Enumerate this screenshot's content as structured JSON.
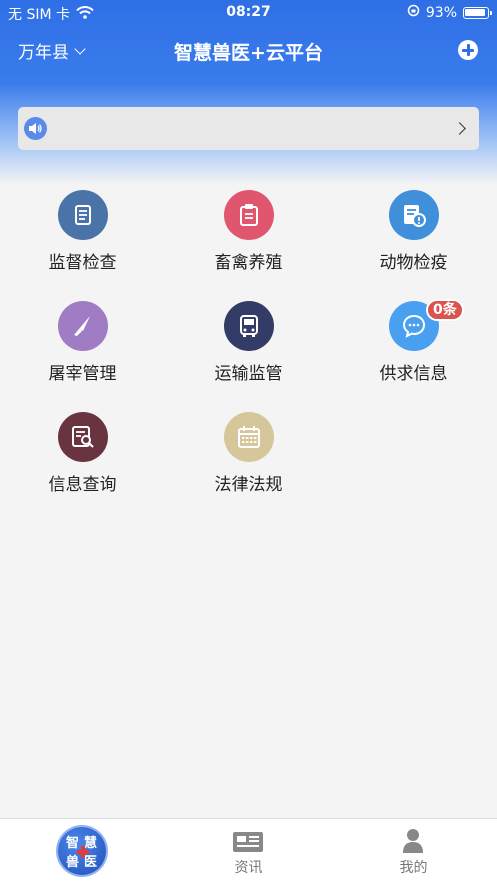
{
  "status_bar": {
    "carrier": "无 SIM 卡",
    "time": "08:27",
    "battery_percent": "93%",
    "battery_level": 0.93
  },
  "nav": {
    "county": "万年县",
    "title": "智慧兽医+云平台"
  },
  "notice": {
    "text": ""
  },
  "menu": {
    "items": [
      {
        "label": "监督检查",
        "icon": "scroll-icon",
        "color": "#4a74a8"
      },
      {
        "label": "畜禽养殖",
        "icon": "clipboard-icon",
        "color": "#e0566e"
      },
      {
        "label": "动物检疫",
        "icon": "document-alert-icon",
        "color": "#3f8fdb"
      },
      {
        "label": "屠宰管理",
        "icon": "knife-icon",
        "color": "#a07cc4"
      },
      {
        "label": "运输监管",
        "icon": "truck-icon",
        "color": "#333c66"
      },
      {
        "label": "供求信息",
        "icon": "chat-bubble-icon",
        "color": "#4aa0f0",
        "badge": "0条"
      },
      {
        "label": "信息查询",
        "icon": "search-list-icon",
        "color": "#6a3340"
      },
      {
        "label": "法律法规",
        "icon": "calendar-icon",
        "color": "#d6c79a"
      }
    ]
  },
  "tabbar": {
    "home": {
      "logo_chars": [
        "智",
        "慧",
        "兽",
        "医"
      ]
    },
    "news": {
      "label": "资讯"
    },
    "mine": {
      "label": "我的"
    }
  },
  "colors": {
    "header_blue": "#2f6fe6",
    "badge_red": "#d9534f"
  }
}
